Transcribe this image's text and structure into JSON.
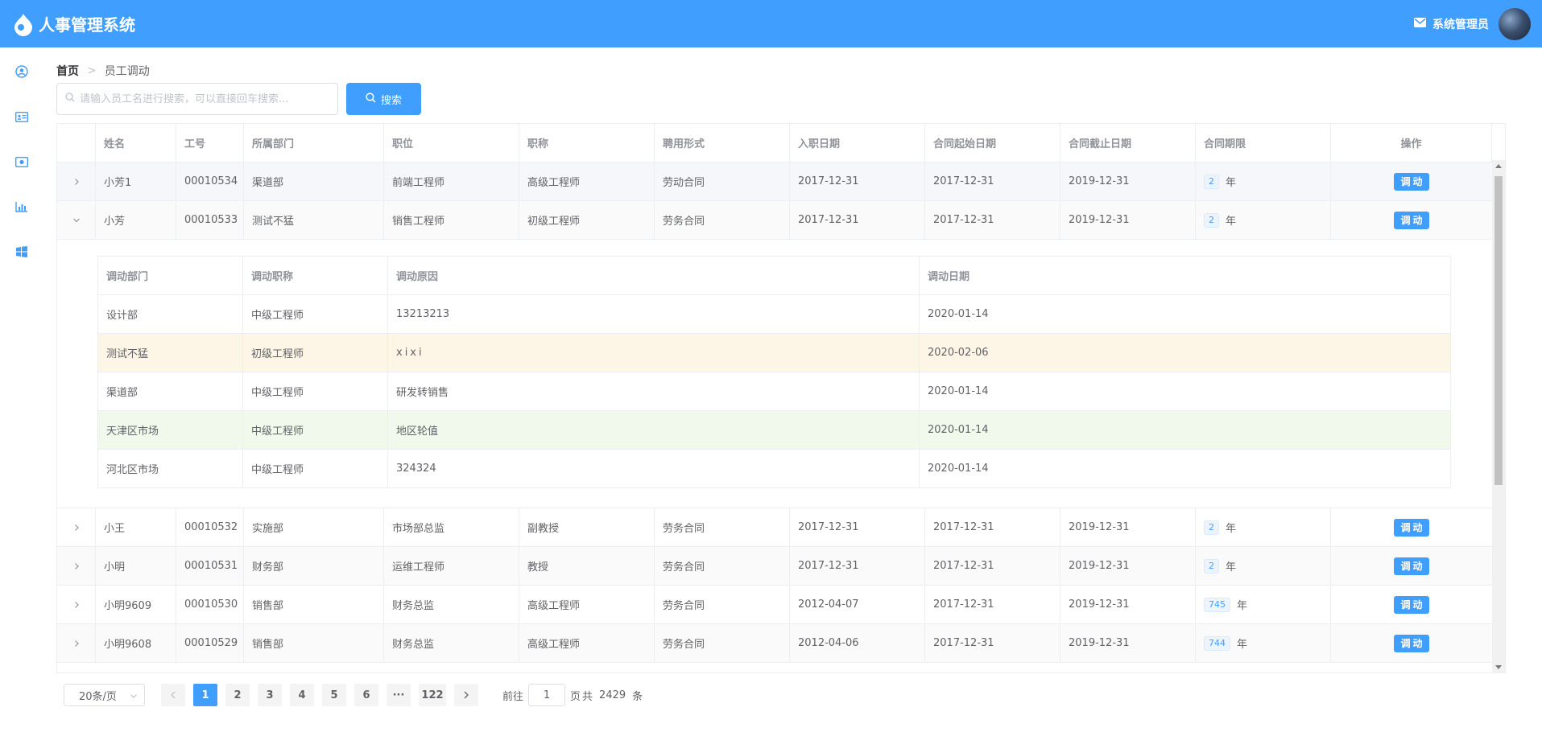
{
  "header": {
    "title": "人事管理系统",
    "user_name": "系统管理员",
    "brand_color": "#409eff"
  },
  "sidebar": {
    "icons": [
      "user-circle-icon",
      "id-card-icon",
      "money-icon",
      "bar-chart-icon",
      "windows-icon"
    ]
  },
  "breadcrumb": {
    "home": "首页",
    "current": "员工调动"
  },
  "search": {
    "placeholder": "请输入员工名进行搜索，可以直接回车搜索...",
    "button_label": "搜索"
  },
  "table": {
    "columns": [
      "姓名",
      "工号",
      "所属部门",
      "职位",
      "职称",
      "聘用形式",
      "入职日期",
      "合同起始日期",
      "合同截止日期",
      "合同期限",
      "操作"
    ],
    "rows": [
      {
        "name": "小芳1",
        "id": "00010534",
        "dept": "渠道部",
        "position": "前端工程师",
        "title": "高级工程师",
        "employ": "劳动合同",
        "join": "2017-12-31",
        "cstart": "2017-12-31",
        "cend": "2019-12-31",
        "term": "2",
        "unit": "年",
        "op": "调动"
      },
      {
        "name": "小芳",
        "id": "00010533",
        "dept": "测试不猛",
        "position": "销售工程师",
        "title": "初级工程师",
        "employ": "劳务合同",
        "join": "2017-12-31",
        "cstart": "2017-12-31",
        "cend": "2019-12-31",
        "term": "2",
        "unit": "年",
        "op": "调动"
      },
      {
        "name": "小王",
        "id": "00010532",
        "dept": "实施部",
        "position": "市场部总监",
        "title": "副教授",
        "employ": "劳务合同",
        "join": "2017-12-31",
        "cstart": "2017-12-31",
        "cend": "2019-12-31",
        "term": "2",
        "unit": "年",
        "op": "调动"
      },
      {
        "name": "小明",
        "id": "00010531",
        "dept": "财务部",
        "position": "运维工程师",
        "title": "教授",
        "employ": "劳务合同",
        "join": "2017-12-31",
        "cstart": "2017-12-31",
        "cend": "2019-12-31",
        "term": "2",
        "unit": "年",
        "op": "调动"
      },
      {
        "name": "小明9609",
        "id": "00010530",
        "dept": "销售部",
        "position": "财务总监",
        "title": "高级工程师",
        "employ": "劳务合同",
        "join": "2012-04-07",
        "cstart": "2017-12-31",
        "cend": "2019-12-31",
        "term": "745",
        "unit": "年",
        "op": "调动"
      },
      {
        "name": "小明9608",
        "id": "00010529",
        "dept": "销售部",
        "position": "财务总监",
        "title": "高级工程师",
        "employ": "劳务合同",
        "join": "2012-04-06",
        "cstart": "2017-12-31",
        "cend": "2019-12-31",
        "term": "744",
        "unit": "年",
        "op": "调动"
      }
    ],
    "expanded": {
      "columns": [
        "调动部门",
        "调动职称",
        "调动原因",
        "调动日期"
      ],
      "rows": [
        {
          "dept": "设计部",
          "title": "中级工程师",
          "reason": "13213213",
          "date": "2020-01-14"
        },
        {
          "dept": "测试不猛",
          "title": "初级工程师",
          "reason": "xixi",
          "date": "2020-02-06"
        },
        {
          "dept": "渠道部",
          "title": "中级工程师",
          "reason": "研发转销售",
          "date": "2020-01-14"
        },
        {
          "dept": "天津区市场",
          "title": "中级工程师",
          "reason": "地区轮值",
          "date": "2020-01-14"
        },
        {
          "dept": "河北区市场",
          "title": "中级工程师",
          "reason": "324324",
          "date": "2020-01-14"
        }
      ]
    }
  },
  "pagination": {
    "page_size": "20条/页",
    "pages": [
      "1",
      "2",
      "3",
      "4",
      "5",
      "6",
      "···",
      "122"
    ],
    "current": "1",
    "goto_prefix": "前往",
    "goto_value": "1",
    "goto_suffix": "页",
    "total_prefix": "共",
    "total": "2429",
    "total_suffix": "条"
  }
}
